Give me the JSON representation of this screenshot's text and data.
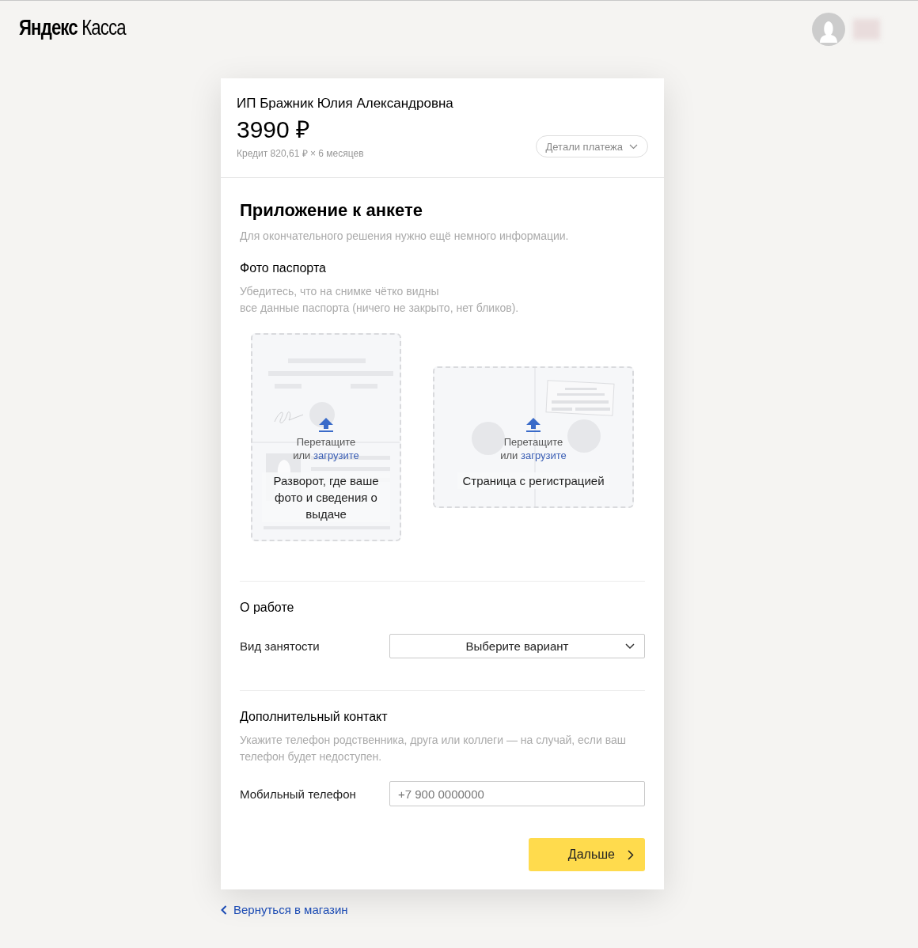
{
  "header": {
    "logo": "**Яндекс** Касса"
  },
  "payment": {
    "merchant": "ИП Бражник Юлия Александровна",
    "amount": "3990 ₽",
    "credit": "Кредит 820,61 ₽ × 6 месяцев",
    "details_button": "Детали платежа"
  },
  "form": {
    "title": "Приложение к анкете",
    "subtitle": "Для окончательного решения нужно ещё немного информации.",
    "sections": [
      {
        "kind": "uploads",
        "title": "Фото паспорта",
        "hint": "Убедитесь, что на снимке чётко видны\nвсе данные паспорта (ничего не закрыто, нет бликов).",
        "uploads": [
          {
            "kind": "passport_spread",
            "drop_text": "Перетащите",
            "or_text": "или",
            "link": "загрузите",
            "caption": "Разворот, где ваше фото и сведения о выдаче"
          },
          {
            "kind": "registration_page",
            "drop_text": "Перетащите",
            "or_text": "или",
            "link": "загрузите",
            "caption": "Страница с регистрацией"
          }
        ]
      },
      {
        "kind": "fields",
        "title": "О работе",
        "fields": [
          {
            "kind": "select",
            "label": "Вид занятости",
            "placeholder": "Выберите вариант"
          }
        ]
      },
      {
        "kind": "fields",
        "title": "Дополнительный контакт",
        "hint": "Укажите телефон родственника, друга или коллеги — на случай, если ваш телефон будет недоступен.",
        "fields": [
          {
            "kind": "input",
            "label": "Мобильный телефон",
            "placeholder": "+7 900 0000000"
          }
        ]
      }
    ],
    "submit": "Дальше"
  },
  "back_link": "Вернуться в магазин"
}
